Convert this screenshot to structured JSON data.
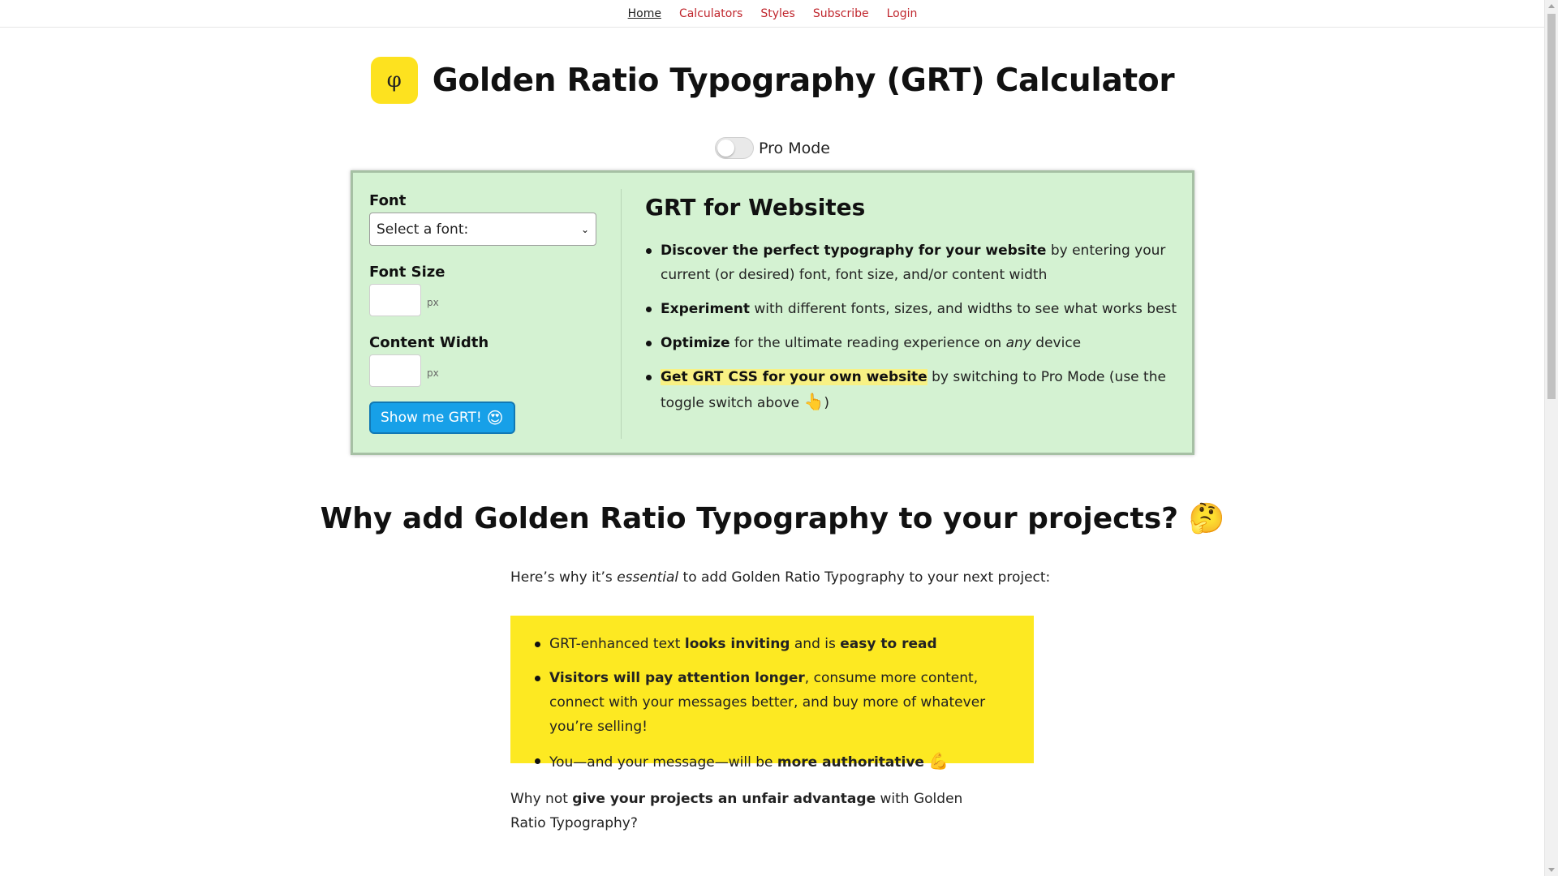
{
  "nav": {
    "items": [
      "Home",
      "Calculators",
      "Styles",
      "Subscribe",
      "Login"
    ]
  },
  "header": {
    "logo_glyph": "φ",
    "title": "Golden Ratio Typography (GRT) Calculator"
  },
  "pro_mode": {
    "label": "Pro Mode",
    "enabled": false
  },
  "form": {
    "font_label": "Font",
    "font_select_value": "Select a font:",
    "font_size_label": "Font Size",
    "font_size_value": "",
    "font_size_unit": "px",
    "content_width_label": "Content Width",
    "content_width_value": "",
    "content_width_unit": "px",
    "button_label": "Show me GRT!",
    "button_emoji": "😍"
  },
  "info": {
    "title": "GRT for Websites",
    "items": [
      {
        "strong": "Discover the perfect typography for your website",
        "rest": " by entering your current (or desired) font, font size, and/or content width"
      },
      {
        "strong": "Experiment",
        "rest": " with different fonts, sizes, and widths to see what works best"
      },
      {
        "strong": "Optimize",
        "rest_before": " for the ultimate reading experience on ",
        "em": "any",
        "rest_after": " device"
      },
      {
        "strong": "Get GRT CSS for your own website",
        "rest": " by switching to Pro Mode (use the toggle switch above ",
        "emoji": "👆",
        "rest_end": ")"
      }
    ]
  },
  "why": {
    "title": "Why add Golden Ratio Typography to your projects?",
    "title_emoji": "🤔",
    "intro_before": "Here’s why it’s ",
    "intro_em": "essential",
    "intro_after": " to add Golden Ratio Typography to your next project:",
    "benefits": [
      {
        "a": "GRT-enhanced text ",
        "b1": "looks inviting",
        "c": " and is ",
        "b2": "easy to read"
      },
      {
        "b1": "Visitors will pay attention longer",
        "c": ", consume more content, connect with your messages better, and buy more of whatever you’re selling!"
      },
      {
        "a": "You—and your message—will be ",
        "b1": "more authoritative",
        "emoji": "💪"
      }
    ],
    "outro_before": "Why not ",
    "outro_strong": "give your projects an unfair advantage",
    "outro_after": " with Golden Ratio Typography?"
  },
  "colors": {
    "nav_link": "#c0262d",
    "logo_bg": "#fde21f",
    "panel_bg": "#d4f2d2",
    "button_bg": "#17a0e8",
    "benefits_bg": "#fde922",
    "highlight": "#f8f184"
  }
}
